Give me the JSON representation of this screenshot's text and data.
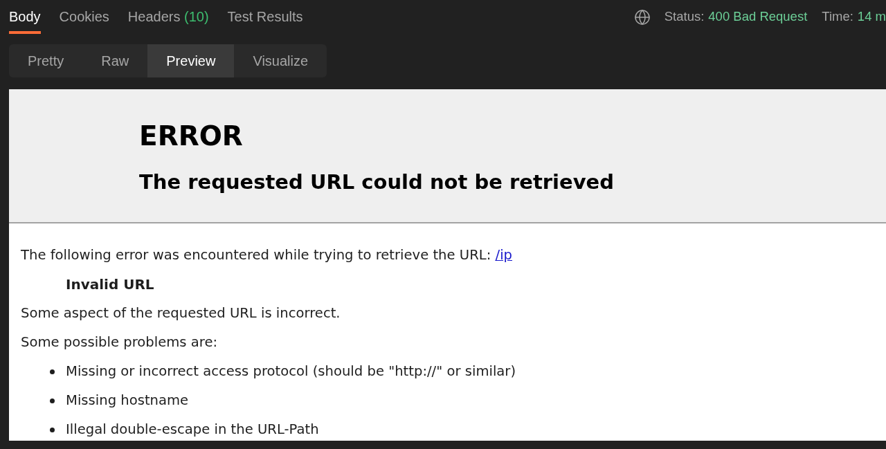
{
  "response_tabs": [
    {
      "label": "Body",
      "selected": true
    },
    {
      "label": "Cookies",
      "selected": false
    },
    {
      "label": "Headers",
      "count": "(10)",
      "selected": false
    },
    {
      "label": "Test Results",
      "selected": false
    }
  ],
  "status_bar": {
    "status_label": "Status:",
    "status_value": "400 Bad Request",
    "time_label": "Time:",
    "time_value": "14 m"
  },
  "view_modes": [
    {
      "label": "Pretty",
      "selected": false
    },
    {
      "label": "Raw",
      "selected": false
    },
    {
      "label": "Preview",
      "selected": true
    },
    {
      "label": "Visualize",
      "selected": false
    }
  ],
  "preview": {
    "title": "ERROR",
    "subtitle": "The requested URL could not be retrieved",
    "intro": "The following error was encountered while trying to retrieve the URL:",
    "url": "/ip",
    "error_name": "Invalid URL",
    "description": "Some aspect of the requested URL is incorrect.",
    "problems_heading": "Some possible problems are:",
    "problems": [
      "Missing or incorrect access protocol (should be \"http://\" or similar)",
      "Missing hostname",
      "Illegal double-escape in the URL-Path"
    ]
  }
}
